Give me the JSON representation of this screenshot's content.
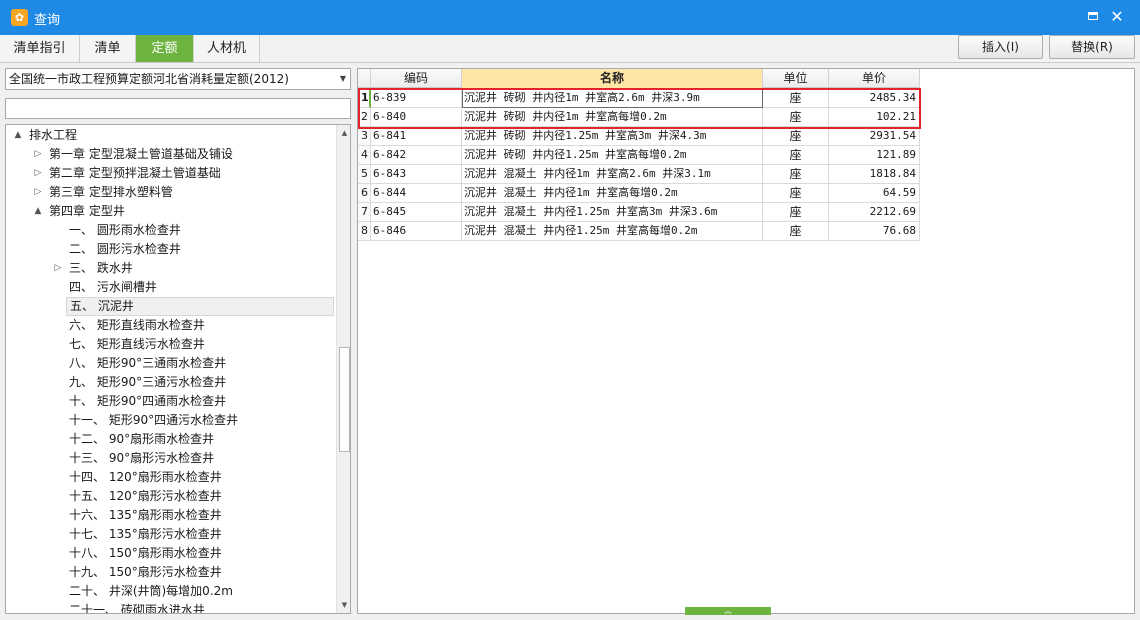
{
  "window": {
    "title": "查询",
    "icon": "app-logo-icon",
    "maximize_icon": "maximize-icon",
    "close_icon": "close-icon"
  },
  "tabs": [
    {
      "label": "清单指引",
      "active": false
    },
    {
      "label": "清单",
      "active": false
    },
    {
      "label": "定额",
      "active": true
    },
    {
      "label": "人材机",
      "active": false
    }
  ],
  "buttons": {
    "insert": "插入(I)",
    "replace": "替换(R)"
  },
  "quota_select": {
    "value": "全国统一市政工程预算定额河北省消耗量定额(2012)"
  },
  "search": {
    "value": ""
  },
  "tree": {
    "items": [
      {
        "label": "排水工程",
        "expander": "▲",
        "selected": false
      },
      {
        "label": "第一章 定型混凝土管道基础及铺设",
        "expander": "▷",
        "selected": false
      },
      {
        "label": "第二章 定型预拌混凝土管道基础",
        "expander": "▷",
        "selected": false
      },
      {
        "label": "第三章 定型排水塑料管",
        "expander": "▷",
        "selected": false
      },
      {
        "label": "第四章 定型井",
        "expander": "▲",
        "selected": false
      },
      {
        "label": "一、 圆形雨水检查井",
        "expander": "",
        "selected": false
      },
      {
        "label": "二、 圆形污水检查井",
        "expander": "",
        "selected": false
      },
      {
        "label": "三、 跌水井",
        "expander": "▷",
        "selected": false
      },
      {
        "label": "四、 污水闸槽井",
        "expander": "",
        "selected": false
      },
      {
        "label": "五、 沉泥井",
        "expander": "",
        "selected": true
      },
      {
        "label": "六、 矩形直线雨水检查井",
        "expander": "",
        "selected": false
      },
      {
        "label": "七、 矩形直线污水检查井",
        "expander": "",
        "selected": false
      },
      {
        "label": "八、 矩形90°三通雨水检查井",
        "expander": "",
        "selected": false
      },
      {
        "label": "九、 矩形90°三通污水检查井",
        "expander": "",
        "selected": false
      },
      {
        "label": "十、 矩形90°四通雨水检查井",
        "expander": "",
        "selected": false
      },
      {
        "label": "十一、 矩形90°四通污水检查井",
        "expander": "",
        "selected": false
      },
      {
        "label": "十二、 90°扇形雨水检查井",
        "expander": "",
        "selected": false
      },
      {
        "label": "十三、 90°扇形污水检查井",
        "expander": "",
        "selected": false
      },
      {
        "label": "十四、 120°扇形雨水检查井",
        "expander": "",
        "selected": false
      },
      {
        "label": "十五、 120°扇形污水检查井",
        "expander": "",
        "selected": false
      },
      {
        "label": "十六、 135°扇形雨水检查井",
        "expander": "",
        "selected": false
      },
      {
        "label": "十七、 135°扇形污水检查井",
        "expander": "",
        "selected": false
      },
      {
        "label": "十八、 150°扇形雨水检查井",
        "expander": "",
        "selected": false
      },
      {
        "label": "十九、 150°扇形污水检查井",
        "expander": "",
        "selected": false
      },
      {
        "label": "二十、 井深(井筒)每增加0.2m",
        "expander": "",
        "selected": false
      },
      {
        "label": "二十一、 砖砌雨水进水井",
        "expander": "",
        "selected": false
      }
    ]
  },
  "grid": {
    "columns": [
      "编码",
      "名称",
      "单位",
      "单价"
    ],
    "rows": [
      {
        "idx": "1",
        "code": "6-839",
        "name": "沉泥井 砖砌 井内径1m 井室高2.6m 井深3.9m",
        "unit": "座",
        "price": "2485.34"
      },
      {
        "idx": "2",
        "code": "6-840",
        "name": "沉泥井 砖砌 井内径1m 井室高每增0.2m",
        "unit": "座",
        "price": "102.21"
      },
      {
        "idx": "3",
        "code": "6-841",
        "name": "沉泥井 砖砌 井内径1.25m 井室高3m 井深4.3m",
        "unit": "座",
        "price": "2931.54"
      },
      {
        "idx": "4",
        "code": "6-842",
        "name": "沉泥井 砖砌 井内径1.25m 井室高每增0.2m",
        "unit": "座",
        "price": "121.89"
      },
      {
        "idx": "5",
        "code": "6-843",
        "name": "沉泥井 混凝土 井内径1m 井室高2.6m 井深3.1m",
        "unit": "座",
        "price": "1818.84"
      },
      {
        "idx": "6",
        "code": "6-844",
        "name": "沉泥井 混凝土 井内径1m 井室高每增0.2m",
        "unit": "座",
        "price": "64.59"
      },
      {
        "idx": "7",
        "code": "6-845",
        "name": "沉泥井 混凝土 井内径1.25m 井室高3m 井深3.6m",
        "unit": "座",
        "price": "2212.69"
      },
      {
        "idx": "8",
        "code": "6-846",
        "name": "沉泥井 混凝土 井内径1.25m 井室高每增0.2m",
        "unit": "座",
        "price": "76.68"
      }
    ]
  },
  "colors": {
    "titlebar": "#1e8ae6",
    "active_tab": "#6db33f",
    "name_header": "#ffe6a6",
    "highlight_box": "#e5232a"
  }
}
